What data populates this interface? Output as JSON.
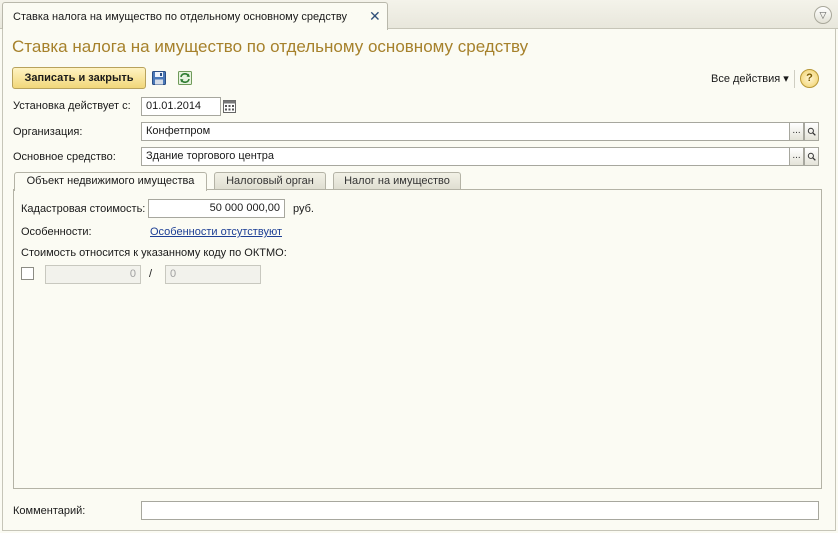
{
  "window": {
    "tab_title": "Ставка налога на имущество по отдельному основному средству",
    "close_glyph": "✕",
    "menu_glyph": "▽"
  },
  "form": {
    "title": "Ставка налога на имущество по отдельному основному средству"
  },
  "toolbar": {
    "save_close_label": "Записать и закрыть",
    "save_icon": "floppy-disk-icon",
    "reread_icon": "refresh-icon",
    "all_actions_label": "Все действия ▾",
    "help_label": "?"
  },
  "fields": {
    "start_date": {
      "label": "Установка действует с:",
      "value": "01.01.2014"
    },
    "organization": {
      "label": "Организация:",
      "value": "Конфетпром"
    },
    "fixed_asset": {
      "label": "Основное средство:",
      "value": "Здание торгового центра"
    },
    "choose_glyph": "...",
    "search_glyph": "🔍"
  },
  "tabs": [
    {
      "label": "Объект недвижимого имущества",
      "active": true
    },
    {
      "label": "Налоговый орган",
      "active": false
    },
    {
      "label": "Налог на имущество",
      "active": false
    }
  ],
  "property_tab": {
    "cadastral_label": "Кадастровая стоимость:",
    "cadastral_value": "50 000 000,00",
    "currency": "руб.",
    "features_label": "Особенности:",
    "features_link": "Особенности отсутствуют",
    "oktmo_label": "Стоимость относится к указанному коду по ОКТМО:",
    "share_numerator": "0",
    "share_separator": "/",
    "share_denominator": "0"
  },
  "comment": {
    "label": "Комментарий:",
    "value": ""
  },
  "colors": {
    "title": "#a6812b",
    "primary_button": "#f1d77a",
    "link": "#1d3f95"
  }
}
